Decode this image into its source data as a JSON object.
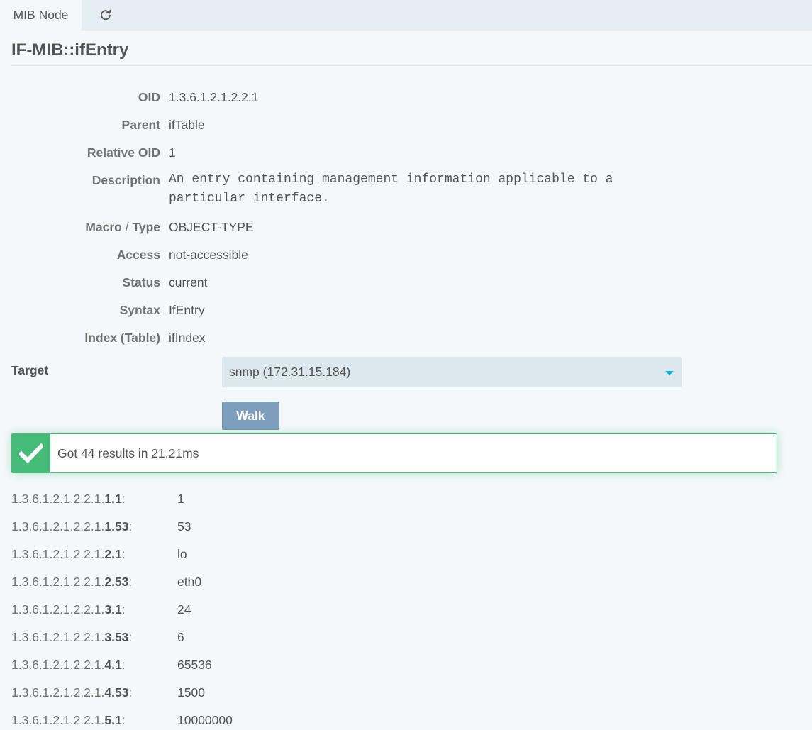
{
  "tabs": {
    "active_label": "MIB Node",
    "refresh_icon": "refresh-icon"
  },
  "node": {
    "title": "IF-MIB::ifEntry"
  },
  "properties": {
    "oid": {
      "label": "OID",
      "value": "1.3.6.1.2.1.2.2.1"
    },
    "parent": {
      "label": "Parent",
      "value": "ifTable"
    },
    "relative_oid": {
      "label": "Relative OID",
      "value": "1"
    },
    "description": {
      "label": "Description",
      "value": "An entry containing management information applicable to a particular interface."
    },
    "macro_type": {
      "label_a": "Macro",
      "label_sep": " / ",
      "label_b": "Type",
      "value": "OBJECT-TYPE"
    },
    "access": {
      "label": "Access",
      "value": "not-accessible"
    },
    "status": {
      "label": "Status",
      "value": "current"
    },
    "syntax": {
      "label": "Syntax",
      "value": "IfEntry"
    },
    "index": {
      "label": "Index (Table)",
      "value": "ifIndex"
    }
  },
  "target": {
    "label": "Target",
    "selected": "snmp (172.31.15.184)"
  },
  "walk_button": {
    "label": "Walk"
  },
  "alert": {
    "icon": "checkmark-icon",
    "message": "Got 44 results in 21.21ms",
    "color": "#44bb77"
  },
  "results": [
    {
      "prefix": "1.3.6.1.2.1.2.2.1.",
      "suffix": "1.1",
      "colon": ":",
      "value": "1"
    },
    {
      "prefix": "1.3.6.1.2.1.2.2.1.",
      "suffix": "1.53",
      "colon": ":",
      "value": "53"
    },
    {
      "prefix": "1.3.6.1.2.1.2.2.1.",
      "suffix": "2.1",
      "colon": ":",
      "value": "lo"
    },
    {
      "prefix": "1.3.6.1.2.1.2.2.1.",
      "suffix": "2.53",
      "colon": ":",
      "value": "eth0"
    },
    {
      "prefix": "1.3.6.1.2.1.2.2.1.",
      "suffix": "3.1",
      "colon": ":",
      "value": "24"
    },
    {
      "prefix": "1.3.6.1.2.1.2.2.1.",
      "suffix": "3.53",
      "colon": ":",
      "value": "6"
    },
    {
      "prefix": "1.3.6.1.2.1.2.2.1.",
      "suffix": "4.1",
      "colon": ":",
      "value": "65536"
    },
    {
      "prefix": "1.3.6.1.2.1.2.2.1.",
      "suffix": "4.53",
      "colon": ":",
      "value": "1500"
    },
    {
      "prefix": "1.3.6.1.2.1.2.2.1.",
      "suffix": "5.1",
      "colon": ":",
      "value": "10000000"
    }
  ]
}
